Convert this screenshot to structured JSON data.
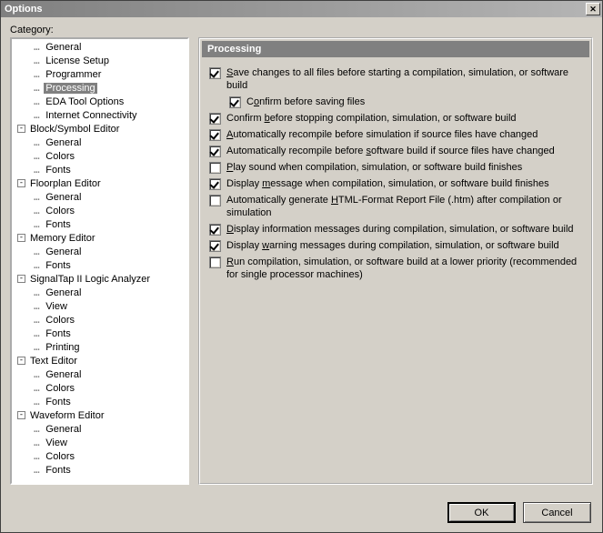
{
  "window": {
    "title": "Options",
    "close_glyph": "✕"
  },
  "category_label": "Category:",
  "tree": [
    {
      "depth": 1,
      "label": "General",
      "selected": false
    },
    {
      "depth": 1,
      "label": "License Setup",
      "selected": false
    },
    {
      "depth": 1,
      "label": "Programmer",
      "selected": false
    },
    {
      "depth": 1,
      "label": "Processing",
      "selected": true
    },
    {
      "depth": 1,
      "label": "EDA Tool Options",
      "selected": false
    },
    {
      "depth": 1,
      "label": "Internet Connectivity",
      "selected": false
    },
    {
      "depth": 0,
      "label": "Block/Symbol Editor",
      "expander": "-",
      "selected": false
    },
    {
      "depth": 1,
      "label": "General",
      "selected": false
    },
    {
      "depth": 1,
      "label": "Colors",
      "selected": false
    },
    {
      "depth": 1,
      "label": "Fonts",
      "selected": false
    },
    {
      "depth": 0,
      "label": "Floorplan Editor",
      "expander": "-",
      "selected": false
    },
    {
      "depth": 1,
      "label": "General",
      "selected": false
    },
    {
      "depth": 1,
      "label": "Colors",
      "selected": false
    },
    {
      "depth": 1,
      "label": "Fonts",
      "selected": false
    },
    {
      "depth": 0,
      "label": "Memory Editor",
      "expander": "-",
      "selected": false
    },
    {
      "depth": 1,
      "label": "General",
      "selected": false
    },
    {
      "depth": 1,
      "label": "Fonts",
      "selected": false
    },
    {
      "depth": 0,
      "label": "SignalTap II Logic Analyzer",
      "expander": "-",
      "selected": false
    },
    {
      "depth": 1,
      "label": "General",
      "selected": false
    },
    {
      "depth": 1,
      "label": "View",
      "selected": false
    },
    {
      "depth": 1,
      "label": "Colors",
      "selected": false
    },
    {
      "depth": 1,
      "label": "Fonts",
      "selected": false
    },
    {
      "depth": 1,
      "label": "Printing",
      "selected": false
    },
    {
      "depth": 0,
      "label": "Text Editor",
      "expander": "-",
      "selected": false
    },
    {
      "depth": 1,
      "label": "General",
      "selected": false
    },
    {
      "depth": 1,
      "label": "Colors",
      "selected": false
    },
    {
      "depth": 1,
      "label": "Fonts",
      "selected": false
    },
    {
      "depth": 0,
      "label": "Waveform Editor",
      "expander": "-",
      "selected": false
    },
    {
      "depth": 1,
      "label": "General",
      "selected": false
    },
    {
      "depth": 1,
      "label": "View",
      "selected": false
    },
    {
      "depth": 1,
      "label": "Colors",
      "selected": false
    },
    {
      "depth": 1,
      "label": "Fonts",
      "selected": false
    }
  ],
  "section": {
    "title": "Processing"
  },
  "options": [
    {
      "checked": true,
      "indent": false,
      "html": "<span class='u'>S</span>ave changes to all files before starting a compilation, simulation, or software build"
    },
    {
      "checked": true,
      "indent": true,
      "html": "C<span class='u'>o</span>nfirm before saving files"
    },
    {
      "checked": true,
      "indent": false,
      "html": "Confirm <span class='u'>b</span>efore stopping compilation, simulation, or software build"
    },
    {
      "checked": true,
      "indent": false,
      "html": "<span class='u'>A</span>utomatically recompile before simulation if source files have changed"
    },
    {
      "checked": true,
      "indent": false,
      "html": "Automatically recompile before <span class='u'>s</span>oftware build if source files have changed"
    },
    {
      "checked": false,
      "indent": false,
      "html": "<span class='u'>P</span>lay sound when compilation, simulation, or software build finishes"
    },
    {
      "checked": true,
      "indent": false,
      "html": "Display <span class='u'>m</span>essage when compilation, simulation, or software build finishes"
    },
    {
      "checked": false,
      "indent": false,
      "html": "Automatically generate <span class='u'>H</span>TML-Format Report File (.htm) after compilation or simulation"
    },
    {
      "checked": true,
      "indent": false,
      "html": "<span class='u'>D</span>isplay information messages during compilation, simulation, or software build"
    },
    {
      "checked": true,
      "indent": false,
      "html": "Display <span class='u'>w</span>arning messages during compilation, simulation, or software build"
    },
    {
      "checked": false,
      "indent": false,
      "html": "<span class='u'>R</span>un compilation, simulation, or software build at a lower priority (recommended for single processor machines)"
    }
  ],
  "buttons": {
    "ok": "OK",
    "cancel": "Cancel"
  }
}
